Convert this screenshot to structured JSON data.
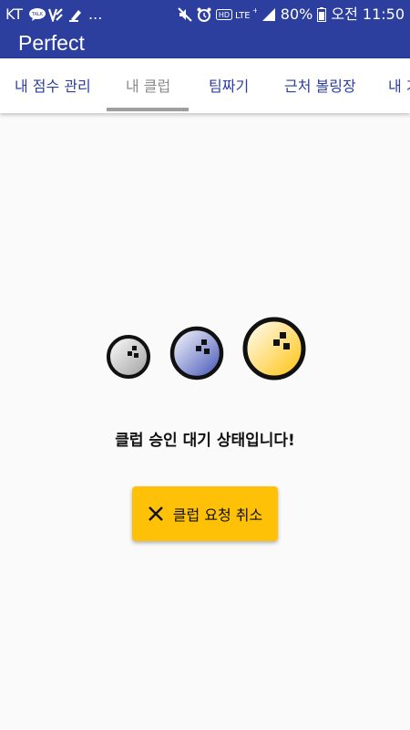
{
  "status_bar": {
    "carrier": "KT",
    "more": "...",
    "battery": "80%",
    "time": "오전 11:50",
    "network": "LTE+"
  },
  "app_bar": {
    "title": "Perfect",
    "color": "#2c3e9e"
  },
  "tabs": [
    {
      "label": "내 점수 관리",
      "active": false
    },
    {
      "label": "내 클럽",
      "active": true
    },
    {
      "label": "팀짜기",
      "active": false
    },
    {
      "label": "근처 볼링장",
      "active": false
    },
    {
      "label": "내 기",
      "active": false
    }
  ],
  "main": {
    "balls": [
      {
        "icon": "bowling-ball-gray-icon",
        "color": "#9e9e9e"
      },
      {
        "icon": "bowling-ball-blue-icon",
        "color": "#5c6bc0"
      },
      {
        "icon": "bowling-ball-yellow-icon",
        "color": "#ffc107"
      }
    ],
    "message": "클럽 승인 대기 상태입니다!",
    "cancel_button": {
      "label": "클럽 요청 취소",
      "icon": "close-icon",
      "color": "#ffc107"
    }
  }
}
